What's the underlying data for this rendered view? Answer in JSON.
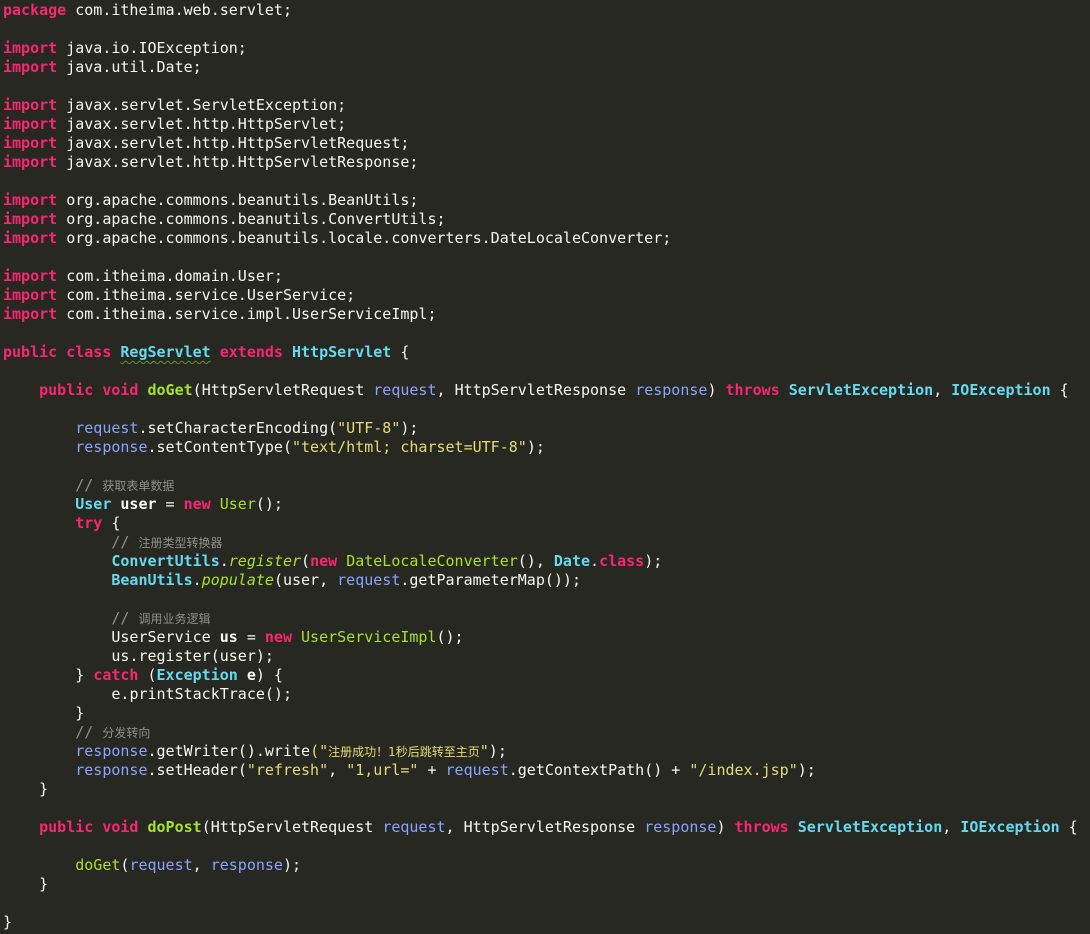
{
  "editor": {
    "background": "#272822",
    "colors": {
      "keyword": "#f92672",
      "type": "#66d9ef",
      "method": "#a6e22e",
      "variable": "#8aa4ff",
      "string": "#e6db74",
      "comment": "#8f908a",
      "plain": "#f8f8f2"
    },
    "lines": [
      [
        {
          "t": "package",
          "c": "keyword"
        },
        {
          "t": " com.itheima.web.servlet;",
          "c": "plain"
        }
      ],
      [],
      [
        {
          "t": "import",
          "c": "keyword"
        },
        {
          "t": " java.io.IOException;",
          "c": "plain"
        }
      ],
      [
        {
          "t": "import",
          "c": "keyword"
        },
        {
          "t": " java.util.Date;",
          "c": "plain"
        }
      ],
      [],
      [
        {
          "t": "import",
          "c": "keyword"
        },
        {
          "t": " javax.servlet.ServletException;",
          "c": "plain"
        }
      ],
      [
        {
          "t": "import",
          "c": "keyword"
        },
        {
          "t": " javax.servlet.http.HttpServlet;",
          "c": "plain"
        }
      ],
      [
        {
          "t": "import",
          "c": "keyword"
        },
        {
          "t": " javax.servlet.http.HttpServletRequest;",
          "c": "plain"
        }
      ],
      [
        {
          "t": "import",
          "c": "keyword"
        },
        {
          "t": " javax.servlet.http.HttpServletResponse;",
          "c": "plain"
        }
      ],
      [],
      [
        {
          "t": "import",
          "c": "keyword"
        },
        {
          "t": " org.apache.commons.beanutils.BeanUtils;",
          "c": "plain"
        }
      ],
      [
        {
          "t": "import",
          "c": "keyword"
        },
        {
          "t": " org.apache.commons.beanutils.ConvertUtils;",
          "c": "plain"
        }
      ],
      [
        {
          "t": "import",
          "c": "keyword"
        },
        {
          "t": " org.apache.commons.beanutils.locale.converters.DateLocaleConverter;",
          "c": "plain"
        }
      ],
      [],
      [
        {
          "t": "import",
          "c": "keyword"
        },
        {
          "t": " com.itheima.domain.User;",
          "c": "plain"
        }
      ],
      [
        {
          "t": "import",
          "c": "keyword"
        },
        {
          "t": " com.itheima.service.UserService;",
          "c": "plain"
        }
      ],
      [
        {
          "t": "import",
          "c": "keyword"
        },
        {
          "t": " com.itheima.service.impl.UserServiceImpl;",
          "c": "plain"
        }
      ],
      [],
      [
        {
          "t": "public",
          "c": "modifier"
        },
        {
          "t": " ",
          "c": "plain"
        },
        {
          "t": "class",
          "c": "keyword"
        },
        {
          "t": " ",
          "c": "plain"
        },
        {
          "t": "RegServlet",
          "c": "classname"
        },
        {
          "t": " ",
          "c": "plain"
        },
        {
          "t": "extends",
          "c": "keyword"
        },
        {
          "t": " ",
          "c": "plain"
        },
        {
          "t": "HttpServlet",
          "c": "type"
        },
        {
          "t": " {",
          "c": "plain"
        }
      ],
      [],
      [
        {
          "t": "    ",
          "c": "plain"
        },
        {
          "t": "public",
          "c": "modifier"
        },
        {
          "t": " ",
          "c": "plain"
        },
        {
          "t": "void",
          "c": "keyword"
        },
        {
          "t": " ",
          "c": "plain"
        },
        {
          "t": "doGet",
          "c": "method-bold"
        },
        {
          "t": "(",
          "c": "plain"
        },
        {
          "t": "HttpServletRequest",
          "c": "plain"
        },
        {
          "t": " ",
          "c": "plain"
        },
        {
          "t": "request",
          "c": "var"
        },
        {
          "t": ", ",
          "c": "plain"
        },
        {
          "t": "HttpServletResponse",
          "c": "plain"
        },
        {
          "t": " ",
          "c": "plain"
        },
        {
          "t": "response",
          "c": "var"
        },
        {
          "t": ") ",
          "c": "plain"
        },
        {
          "t": "throws",
          "c": "keyword"
        },
        {
          "t": " ",
          "c": "plain"
        },
        {
          "t": "ServletException",
          "c": "type"
        },
        {
          "t": ", ",
          "c": "plain"
        },
        {
          "t": "IOException",
          "c": "type"
        },
        {
          "t": " {",
          "c": "plain"
        }
      ],
      [],
      [
        {
          "t": "        ",
          "c": "plain"
        },
        {
          "t": "request",
          "c": "var"
        },
        {
          "t": ".",
          "c": "plain"
        },
        {
          "t": "setCharacterEncoding",
          "c": "plain"
        },
        {
          "t": "(",
          "c": "plain"
        },
        {
          "t": "\"UTF-8\"",
          "c": "string"
        },
        {
          "t": ");",
          "c": "plain"
        }
      ],
      [
        {
          "t": "        ",
          "c": "plain"
        },
        {
          "t": "response",
          "c": "var"
        },
        {
          "t": ".",
          "c": "plain"
        },
        {
          "t": "setContentType",
          "c": "plain"
        },
        {
          "t": "(",
          "c": "plain"
        },
        {
          "t": "\"text/html; charset=UTF-8\"",
          "c": "string"
        },
        {
          "t": ");",
          "c": "plain"
        }
      ],
      [],
      [
        {
          "t": "        ",
          "c": "plain"
        },
        {
          "t": "// ",
          "c": "comment"
        },
        {
          "t": "获取表单数据",
          "c": "comment-cn"
        }
      ],
      [
        {
          "t": "        ",
          "c": "plain"
        },
        {
          "t": "User",
          "c": "type"
        },
        {
          "t": " ",
          "c": "plain"
        },
        {
          "t": "user",
          "c": "boldvar"
        },
        {
          "t": " = ",
          "c": "plain"
        },
        {
          "t": "new",
          "c": "keyword"
        },
        {
          "t": " ",
          "c": "plain"
        },
        {
          "t": "User",
          "c": "method"
        },
        {
          "t": "();",
          "c": "plain"
        }
      ],
      [
        {
          "t": "        ",
          "c": "plain"
        },
        {
          "t": "try",
          "c": "keyword"
        },
        {
          "t": " {",
          "c": "plain"
        }
      ],
      [
        {
          "t": "            ",
          "c": "plain"
        },
        {
          "t": "// ",
          "c": "comment"
        },
        {
          "t": "注册类型转换器",
          "c": "comment-cn"
        }
      ],
      [
        {
          "t": "            ",
          "c": "plain"
        },
        {
          "t": "ConvertUtils",
          "c": "type"
        },
        {
          "t": ".",
          "c": "plain"
        },
        {
          "t": "register",
          "c": "static"
        },
        {
          "t": "(",
          "c": "plain"
        },
        {
          "t": "new",
          "c": "keyword"
        },
        {
          "t": " ",
          "c": "plain"
        },
        {
          "t": "DateLocaleConverter",
          "c": "method"
        },
        {
          "t": "(), ",
          "c": "plain"
        },
        {
          "t": "Date",
          "c": "type"
        },
        {
          "t": ".",
          "c": "plain"
        },
        {
          "t": "class",
          "c": "keyword"
        },
        {
          "t": ");",
          "c": "plain"
        }
      ],
      [
        {
          "t": "            ",
          "c": "plain"
        },
        {
          "t": "BeanUtils",
          "c": "type"
        },
        {
          "t": ".",
          "c": "plain"
        },
        {
          "t": "populate",
          "c": "static"
        },
        {
          "t": "(",
          "c": "plain"
        },
        {
          "t": "user",
          "c": "plain"
        },
        {
          "t": ", ",
          "c": "plain"
        },
        {
          "t": "request",
          "c": "var"
        },
        {
          "t": ".",
          "c": "plain"
        },
        {
          "t": "getParameterMap",
          "c": "plain"
        },
        {
          "t": "());",
          "c": "plain"
        }
      ],
      [],
      [
        {
          "t": "            ",
          "c": "plain"
        },
        {
          "t": "// ",
          "c": "comment"
        },
        {
          "t": "调用业务逻辑",
          "c": "comment-cn"
        }
      ],
      [
        {
          "t": "            ",
          "c": "plain"
        },
        {
          "t": "UserService",
          "c": "plain"
        },
        {
          "t": " ",
          "c": "plain"
        },
        {
          "t": "us",
          "c": "boldvar"
        },
        {
          "t": " = ",
          "c": "plain"
        },
        {
          "t": "new",
          "c": "keyword"
        },
        {
          "t": " ",
          "c": "plain"
        },
        {
          "t": "UserServiceImpl",
          "c": "method"
        },
        {
          "t": "();",
          "c": "plain"
        }
      ],
      [
        {
          "t": "            ",
          "c": "plain"
        },
        {
          "t": "us",
          "c": "plain"
        },
        {
          "t": ".",
          "c": "plain"
        },
        {
          "t": "register",
          "c": "plain"
        },
        {
          "t": "(",
          "c": "plain"
        },
        {
          "t": "user",
          "c": "plain"
        },
        {
          "t": ");",
          "c": "plain"
        }
      ],
      [
        {
          "t": "        } ",
          "c": "plain"
        },
        {
          "t": "catch",
          "c": "keyword"
        },
        {
          "t": " (",
          "c": "plain"
        },
        {
          "t": "Exception",
          "c": "type"
        },
        {
          "t": " ",
          "c": "plain"
        },
        {
          "t": "e",
          "c": "boldvar"
        },
        {
          "t": ") {",
          "c": "plain"
        }
      ],
      [
        {
          "t": "            ",
          "c": "plain"
        },
        {
          "t": "e",
          "c": "plain"
        },
        {
          "t": ".",
          "c": "plain"
        },
        {
          "t": "printStackTrace",
          "c": "plain"
        },
        {
          "t": "();",
          "c": "plain"
        }
      ],
      [
        {
          "t": "        }",
          "c": "plain"
        }
      ],
      [
        {
          "t": "        ",
          "c": "plain"
        },
        {
          "t": "// ",
          "c": "comment"
        },
        {
          "t": "分发转向",
          "c": "comment-cn"
        }
      ],
      [
        {
          "t": "        ",
          "c": "plain"
        },
        {
          "t": "response",
          "c": "var"
        },
        {
          "t": ".",
          "c": "plain"
        },
        {
          "t": "getWriter",
          "c": "plain"
        },
        {
          "t": "().",
          "c": "plain"
        },
        {
          "t": "write",
          "c": "plain"
        },
        {
          "t": "(\"",
          "c": "string"
        },
        {
          "t": "注册成功！1秒后跳转至主页",
          "c": "string-cn"
        },
        {
          "t": "\"",
          "c": "string"
        },
        {
          "t": ");",
          "c": "plain"
        }
      ],
      [
        {
          "t": "        ",
          "c": "plain"
        },
        {
          "t": "response",
          "c": "var"
        },
        {
          "t": ".",
          "c": "plain"
        },
        {
          "t": "setHeader",
          "c": "plain"
        },
        {
          "t": "(",
          "c": "plain"
        },
        {
          "t": "\"refresh\"",
          "c": "string"
        },
        {
          "t": ", ",
          "c": "plain"
        },
        {
          "t": "\"1,url=\"",
          "c": "string"
        },
        {
          "t": " + ",
          "c": "plain"
        },
        {
          "t": "request",
          "c": "var"
        },
        {
          "t": ".",
          "c": "plain"
        },
        {
          "t": "getContextPath",
          "c": "plain"
        },
        {
          "t": "() + ",
          "c": "plain"
        },
        {
          "t": "\"/index.jsp\"",
          "c": "string"
        },
        {
          "t": ");",
          "c": "plain"
        }
      ],
      [
        {
          "t": "    }",
          "c": "plain"
        }
      ],
      [],
      [
        {
          "t": "    ",
          "c": "plain"
        },
        {
          "t": "public",
          "c": "modifier"
        },
        {
          "t": " ",
          "c": "plain"
        },
        {
          "t": "void",
          "c": "keyword"
        },
        {
          "t": " ",
          "c": "plain"
        },
        {
          "t": "doPost",
          "c": "method-bold"
        },
        {
          "t": "(",
          "c": "plain"
        },
        {
          "t": "HttpServletRequest",
          "c": "plain"
        },
        {
          "t": " ",
          "c": "plain"
        },
        {
          "t": "request",
          "c": "var"
        },
        {
          "t": ", ",
          "c": "plain"
        },
        {
          "t": "HttpServletResponse",
          "c": "plain"
        },
        {
          "t": " ",
          "c": "plain"
        },
        {
          "t": "response",
          "c": "var"
        },
        {
          "t": ") ",
          "c": "plain"
        },
        {
          "t": "throws",
          "c": "keyword"
        },
        {
          "t": " ",
          "c": "plain"
        },
        {
          "t": "ServletException",
          "c": "type"
        },
        {
          "t": ", ",
          "c": "plain"
        },
        {
          "t": "IOException",
          "c": "type"
        },
        {
          "t": " {",
          "c": "plain"
        }
      ],
      [],
      [
        {
          "t": "        ",
          "c": "plain"
        },
        {
          "t": "doGet",
          "c": "method"
        },
        {
          "t": "(",
          "c": "plain"
        },
        {
          "t": "request",
          "c": "var"
        },
        {
          "t": ", ",
          "c": "plain"
        },
        {
          "t": "response",
          "c": "var"
        },
        {
          "t": ");",
          "c": "plain"
        }
      ],
      [
        {
          "t": "    }",
          "c": "plain"
        }
      ],
      [],
      [
        {
          "t": "}",
          "c": "plain"
        }
      ]
    ]
  }
}
